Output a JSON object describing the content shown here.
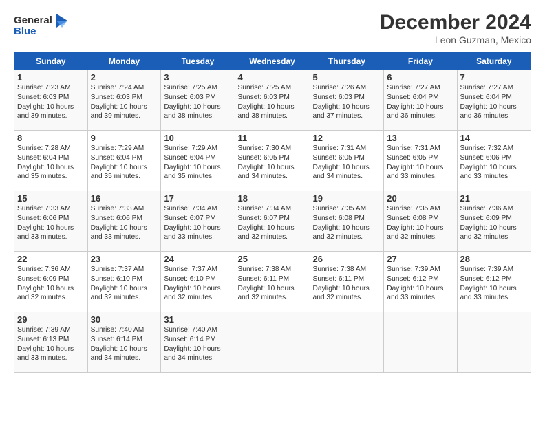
{
  "logo": {
    "line1": "General",
    "line2": "Blue"
  },
  "title": "December 2024",
  "subtitle": "Leon Guzman, Mexico",
  "days_of_week": [
    "Sunday",
    "Monday",
    "Tuesday",
    "Wednesday",
    "Thursday",
    "Friday",
    "Saturday"
  ],
  "weeks": [
    [
      {
        "day": "1",
        "info": "Sunrise: 7:23 AM\nSunset: 6:03 PM\nDaylight: 10 hours\nand 39 minutes."
      },
      {
        "day": "2",
        "info": "Sunrise: 7:24 AM\nSunset: 6:03 PM\nDaylight: 10 hours\nand 39 minutes."
      },
      {
        "day": "3",
        "info": "Sunrise: 7:25 AM\nSunset: 6:03 PM\nDaylight: 10 hours\nand 38 minutes."
      },
      {
        "day": "4",
        "info": "Sunrise: 7:25 AM\nSunset: 6:03 PM\nDaylight: 10 hours\nand 38 minutes."
      },
      {
        "day": "5",
        "info": "Sunrise: 7:26 AM\nSunset: 6:03 PM\nDaylight: 10 hours\nand 37 minutes."
      },
      {
        "day": "6",
        "info": "Sunrise: 7:27 AM\nSunset: 6:04 PM\nDaylight: 10 hours\nand 36 minutes."
      },
      {
        "day": "7",
        "info": "Sunrise: 7:27 AM\nSunset: 6:04 PM\nDaylight: 10 hours\nand 36 minutes."
      }
    ],
    [
      {
        "day": "8",
        "info": "Sunrise: 7:28 AM\nSunset: 6:04 PM\nDaylight: 10 hours\nand 35 minutes."
      },
      {
        "day": "9",
        "info": "Sunrise: 7:29 AM\nSunset: 6:04 PM\nDaylight: 10 hours\nand 35 minutes."
      },
      {
        "day": "10",
        "info": "Sunrise: 7:29 AM\nSunset: 6:04 PM\nDaylight: 10 hours\nand 35 minutes."
      },
      {
        "day": "11",
        "info": "Sunrise: 7:30 AM\nSunset: 6:05 PM\nDaylight: 10 hours\nand 34 minutes."
      },
      {
        "day": "12",
        "info": "Sunrise: 7:31 AM\nSunset: 6:05 PM\nDaylight: 10 hours\nand 34 minutes."
      },
      {
        "day": "13",
        "info": "Sunrise: 7:31 AM\nSunset: 6:05 PM\nDaylight: 10 hours\nand 33 minutes."
      },
      {
        "day": "14",
        "info": "Sunrise: 7:32 AM\nSunset: 6:06 PM\nDaylight: 10 hours\nand 33 minutes."
      }
    ],
    [
      {
        "day": "15",
        "info": "Sunrise: 7:33 AM\nSunset: 6:06 PM\nDaylight: 10 hours\nand 33 minutes."
      },
      {
        "day": "16",
        "info": "Sunrise: 7:33 AM\nSunset: 6:06 PM\nDaylight: 10 hours\nand 33 minutes."
      },
      {
        "day": "17",
        "info": "Sunrise: 7:34 AM\nSunset: 6:07 PM\nDaylight: 10 hours\nand 33 minutes."
      },
      {
        "day": "18",
        "info": "Sunrise: 7:34 AM\nSunset: 6:07 PM\nDaylight: 10 hours\nand 32 minutes."
      },
      {
        "day": "19",
        "info": "Sunrise: 7:35 AM\nSunset: 6:08 PM\nDaylight: 10 hours\nand 32 minutes."
      },
      {
        "day": "20",
        "info": "Sunrise: 7:35 AM\nSunset: 6:08 PM\nDaylight: 10 hours\nand 32 minutes."
      },
      {
        "day": "21",
        "info": "Sunrise: 7:36 AM\nSunset: 6:09 PM\nDaylight: 10 hours\nand 32 minutes."
      }
    ],
    [
      {
        "day": "22",
        "info": "Sunrise: 7:36 AM\nSunset: 6:09 PM\nDaylight: 10 hours\nand 32 minutes."
      },
      {
        "day": "23",
        "info": "Sunrise: 7:37 AM\nSunset: 6:10 PM\nDaylight: 10 hours\nand 32 minutes."
      },
      {
        "day": "24",
        "info": "Sunrise: 7:37 AM\nSunset: 6:10 PM\nDaylight: 10 hours\nand 32 minutes."
      },
      {
        "day": "25",
        "info": "Sunrise: 7:38 AM\nSunset: 6:11 PM\nDaylight: 10 hours\nand 32 minutes."
      },
      {
        "day": "26",
        "info": "Sunrise: 7:38 AM\nSunset: 6:11 PM\nDaylight: 10 hours\nand 32 minutes."
      },
      {
        "day": "27",
        "info": "Sunrise: 7:39 AM\nSunset: 6:12 PM\nDaylight: 10 hours\nand 33 minutes."
      },
      {
        "day": "28",
        "info": "Sunrise: 7:39 AM\nSunset: 6:12 PM\nDaylight: 10 hours\nand 33 minutes."
      }
    ],
    [
      {
        "day": "29",
        "info": "Sunrise: 7:39 AM\nSunset: 6:13 PM\nDaylight: 10 hours\nand 33 minutes."
      },
      {
        "day": "30",
        "info": "Sunrise: 7:40 AM\nSunset: 6:14 PM\nDaylight: 10 hours\nand 34 minutes."
      },
      {
        "day": "31",
        "info": "Sunrise: 7:40 AM\nSunset: 6:14 PM\nDaylight: 10 hours\nand 34 minutes."
      },
      {
        "day": "",
        "info": ""
      },
      {
        "day": "",
        "info": ""
      },
      {
        "day": "",
        "info": ""
      },
      {
        "day": "",
        "info": ""
      }
    ]
  ]
}
